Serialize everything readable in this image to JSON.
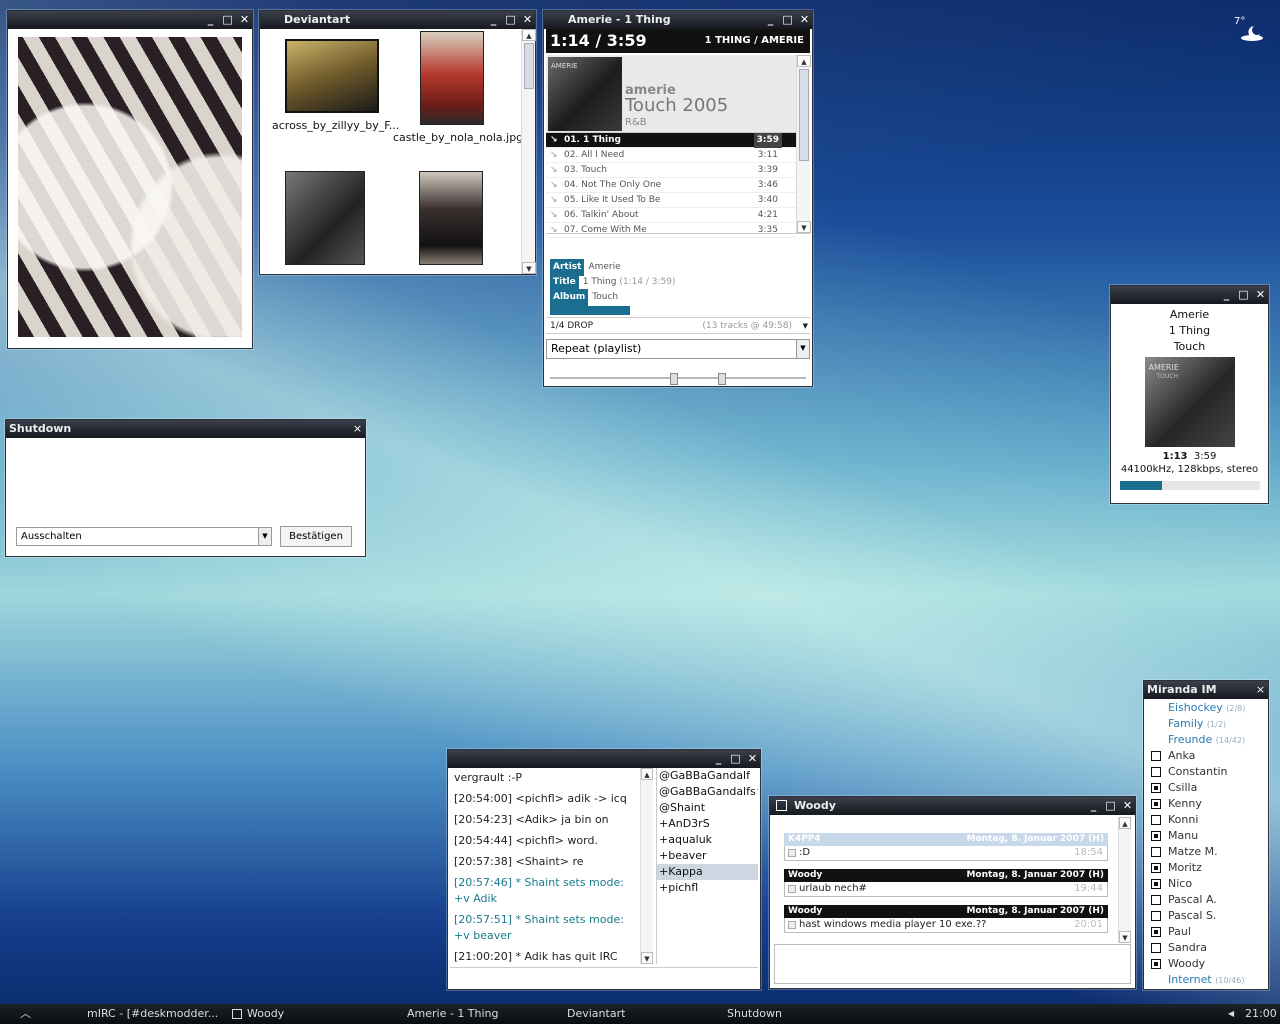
{
  "desktop": {
    "weather_temp": "7°"
  },
  "photo_window": {
    "title": ""
  },
  "deviantart": {
    "title": "Deviantart",
    "thumbs": [
      {
        "caption": "across_by_zillyy_by_F..."
      },
      {
        "caption": "castle_by_nola_nola.jpg"
      },
      {
        "caption": ""
      },
      {
        "caption": ""
      }
    ]
  },
  "player": {
    "title": "Amerie -  1 Thing",
    "time": "1:14 / 3:59",
    "now_playing_short": "1 THING / AMERIE",
    "album_artist_text": "amerie",
    "album_title_text": "Touch 2005",
    "genre": "R&B",
    "cover_text": "AMERIE",
    "tracks": [
      {
        "name": "01. 1 Thing",
        "time": "3:59",
        "active": true
      },
      {
        "name": "02. All I Need",
        "time": "3:11"
      },
      {
        "name": "03. Touch",
        "time": "3:39"
      },
      {
        "name": "04. Not The Only One",
        "time": "3:46"
      },
      {
        "name": "05. Like It Used To Be",
        "time": "3:40"
      },
      {
        "name": "06. Talkin' About",
        "time": "4:21"
      },
      {
        "name": "07. Come With Me",
        "time": "3:35"
      }
    ],
    "info": {
      "artist_label": "Artist",
      "artist": "Amerie",
      "title_label": "Title",
      "title": "1 Thing",
      "title_extra": "(1:14 / 3:59)",
      "album_label": "Album",
      "album": "Touch"
    },
    "progress": 0.31,
    "playlist": {
      "name": "1/4 DROP",
      "summary": "(13 tracks @ 49:58)"
    },
    "repeat_mode": "Repeat (playlist)"
  },
  "shutdown": {
    "title": "Shutdown",
    "close": "×",
    "select_value": "Ausschalten",
    "confirm_label": "Bestätigen"
  },
  "mini_player": {
    "artist": "Amerie",
    "title": "1 Thing",
    "album": "Touch",
    "cover_text": "AMERIE",
    "cover_sub": "TOUCH",
    "elapsed": "1:13",
    "total": "3:59",
    "format": "44100kHz, 128kbps, stereo",
    "progress": 0.3
  },
  "miranda": {
    "title": "Miranda IM",
    "close": "×",
    "groups_top": [
      {
        "name": "Eishockey",
        "count": "(2/8)"
      },
      {
        "name": "Family",
        "count": "(1/2)"
      },
      {
        "name": "Freunde",
        "count": "(14/42)"
      }
    ],
    "contacts": [
      {
        "name": "Anka",
        "online": false
      },
      {
        "name": "Constantin",
        "online": false
      },
      {
        "name": "Csilla",
        "online": true
      },
      {
        "name": "Kenny",
        "online": true
      },
      {
        "name": "Konni",
        "online": false
      },
      {
        "name": "Manu",
        "online": true
      },
      {
        "name": "Matze M.",
        "online": false
      },
      {
        "name": "Moritz",
        "online": true
      },
      {
        "name": "Nico",
        "online": true
      },
      {
        "name": "Pascal A.",
        "online": false
      },
      {
        "name": "Pascal S.",
        "online": false
      },
      {
        "name": "Paul",
        "online": true
      },
      {
        "name": "Sandra",
        "online": false
      },
      {
        "name": "Woody",
        "online": true
      }
    ],
    "group_bottom": {
      "name": "Internet",
      "count": "(10/46)"
    }
  },
  "irc": {
    "lines": [
      {
        "text": " vergrault :-P",
        "mode": false
      },
      {
        "text": "[20:54:00] <pichfl> adik -> icq",
        "mode": false
      },
      {
        "text": "[20:54:23] <Adik> ja bin on",
        "mode": false
      },
      {
        "text": "[20:54:44] <pichfl> word.",
        "mode": false
      },
      {
        "text": "[20:57:38] <Shaint> re",
        "mode": false
      },
      {
        "text": "[20:57:46] * Shaint sets mode: +v Adik",
        "mode": true
      },
      {
        "text": "[20:57:51] * Shaint sets mode: +v beaver",
        "mode": true
      },
      {
        "text": "[21:00:20] * Adik has quit IRC",
        "mode": false
      }
    ],
    "nicks": [
      {
        "name": "@GaBBaGandalf"
      },
      {
        "name": "@GaBBaGandalfs^"
      },
      {
        "name": "@Shaint"
      },
      {
        "name": "+AnD3rS"
      },
      {
        "name": "+aqualuk"
      },
      {
        "name": "+beaver"
      },
      {
        "name": "+Kappa",
        "selected": true
      },
      {
        "name": "+pichfl"
      }
    ]
  },
  "chat": {
    "title": "Woody",
    "messages": [
      {
        "sender": "K4PP4",
        "date": "Montag, 8. Januar 2007 (H)",
        "text": ":D",
        "time": "18:54",
        "alt": true
      },
      {
        "sender": "Woody",
        "date": "Montag, 8. Januar 2007 (H)",
        "text": "urlaub nech#",
        "time": "19:44"
      },
      {
        "sender": "Woody",
        "date": "Montag, 8. Januar 2007 (H)",
        "text": "hast windows media player 10 exe.??",
        "time": "20:01"
      }
    ]
  },
  "taskbar": {
    "items": [
      {
        "label": "mIRC - [#deskmodder..."
      },
      {
        "label": "Woody"
      },
      {
        "label": "Amerie -  1 Thing"
      },
      {
        "label": "Deviantart"
      },
      {
        "label": "Shutdown"
      }
    ],
    "clock": "21:00"
  }
}
